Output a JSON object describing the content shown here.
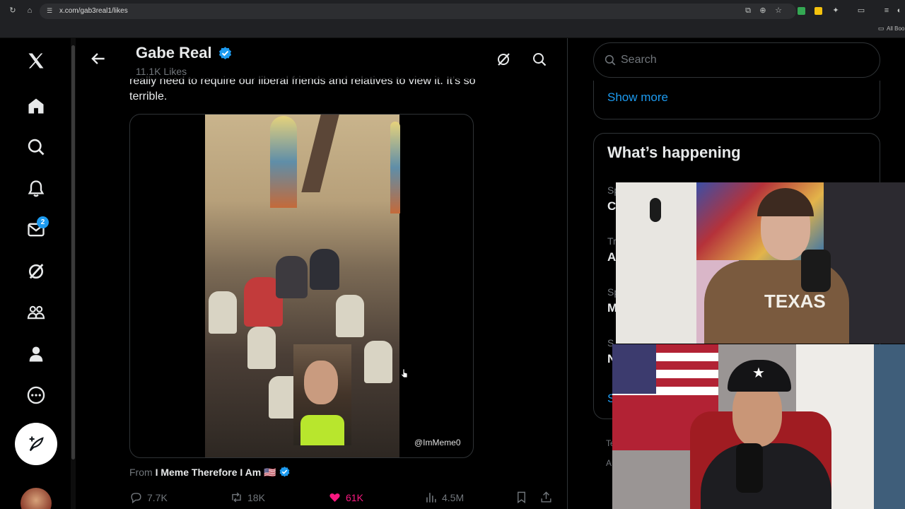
{
  "browser": {
    "url": "x.com/gab3real1/likes",
    "bookmarks_label": "All Boo"
  },
  "nav": {
    "messages_badge": "2"
  },
  "header": {
    "name": "Gabe Real",
    "likes": "11.1K Likes"
  },
  "tweet": {
    "text_line1": "really need to require our liberal friends and relatives to view it. It's so",
    "text_line2": "terrible.",
    "watermark": "@ImMeme0",
    "from_prefix": "From",
    "from_name": "I Meme Therefore I Am",
    "from_flag": "🇺🇸",
    "replies": "7.7K",
    "reposts": "18K",
    "likes": "61K",
    "views": "4.5M"
  },
  "sidebar": {
    "search_placeholder": "Search",
    "show_more": "Show more",
    "happening_title": "What’s happening",
    "fragments": [
      "Sp",
      "C",
      "Tr",
      "A",
      "Sp",
      "M",
      "S",
      "N",
      "S"
    ],
    "footer_fragments": [
      "Te",
      "A"
    ]
  },
  "colors": {
    "accent": "#1d9bf0",
    "like": "#f91880",
    "muted": "#71767b",
    "text": "#e7e9ea",
    "border": "#2f3336"
  }
}
